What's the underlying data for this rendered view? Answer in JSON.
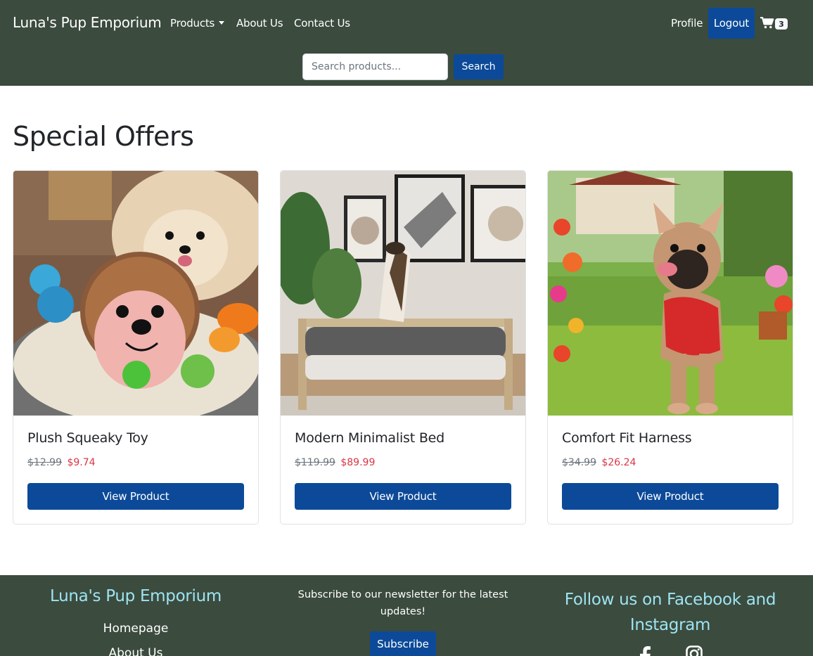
{
  "navbar": {
    "brand": "Luna's Pup Emporium",
    "links": {
      "products": "Products",
      "about": "About Us",
      "contact": "Contact Us"
    },
    "profile": "Profile",
    "logout": "Logout",
    "cart_count": "3",
    "cart_icon": "shopping-cart-icon"
  },
  "search": {
    "placeholder": "Search products...",
    "value": "",
    "button": "Search"
  },
  "main": {
    "heading": "Special Offers",
    "products": [
      {
        "title": "Plush Squeaky Toy",
        "old_price": "$12.99",
        "new_price": "$9.74",
        "button": "View Product"
      },
      {
        "title": "Modern Minimalist Bed",
        "old_price": "$119.99",
        "new_price": "$89.99",
        "button": "View Product"
      },
      {
        "title": "Comfort Fit Harness",
        "old_price": "$34.99",
        "new_price": "$26.24",
        "button": "View Product"
      }
    ]
  },
  "footer": {
    "brand": "Luna's Pup Emporium",
    "links": [
      "Homepage",
      "About Us"
    ],
    "newsletter": "Subscribe to our newsletter for the latest updates!",
    "subscribe": "Subscribe",
    "follow": "Follow us on Facebook and Instagram",
    "social_icons": [
      "facebook-icon",
      "instagram-icon"
    ]
  },
  "colors": {
    "nav_bg": "#3b4b3e",
    "primary": "#0c4a99",
    "sale_price": "#dc3545",
    "footer_accent": "#9ee4f2"
  }
}
